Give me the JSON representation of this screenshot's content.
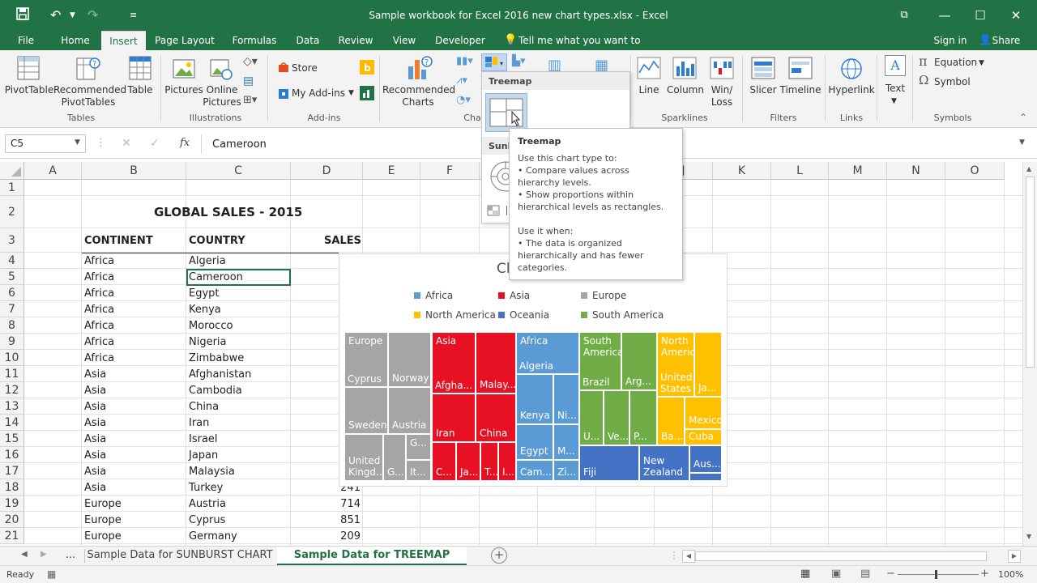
{
  "window": {
    "title": "Sample workbook for Excel 2016 new chart types.xlsx - Excel",
    "controls": [
      "⧉",
      "—",
      "☐",
      "✕"
    ]
  },
  "tabs": {
    "items": [
      "File",
      "Home",
      "Insert",
      "Page Layout",
      "Formulas",
      "Data",
      "Review",
      "View",
      "Developer"
    ],
    "active": "Insert",
    "tell_me": "Tell me what you want to do",
    "sign_in": "Sign in",
    "share": "Share"
  },
  "ribbon": {
    "pivottable": "PivotTable",
    "recommended_pivot_1": "Recommended",
    "recommended_pivot_2": "PivotTables",
    "table": "Table",
    "pictures": "Pictures",
    "online_1": "Online",
    "online_2": "Pictures",
    "store": "Store",
    "my_addins": "My Add-ins",
    "recommended_charts_1": "Recommended",
    "recommended_charts_2": "Charts",
    "line": "Line",
    "column": "Column",
    "winloss_1": "Win/",
    "winloss_2": "Loss",
    "slicer": "Slicer",
    "timeline": "Timeline",
    "hyperlink": "Hyperlink",
    "text": "Text",
    "equation": "Equation",
    "symbol": "Symbol",
    "groups": {
      "tables": "Tables",
      "illustrations": "Illustrations",
      "addins": "Add-ins",
      "charts": "Cha",
      "sparklines": "Sparklines",
      "filters": "Filters",
      "links": "Links",
      "symbols": "Symbols"
    }
  },
  "formula_bar": {
    "name_box": "C5",
    "fx": "fx",
    "value": "Cameroon"
  },
  "columns": [
    "A",
    "B",
    "C",
    "D",
    "E",
    "F",
    "G",
    "H",
    "I",
    "J",
    "K",
    "L",
    "M",
    "N",
    "O"
  ],
  "rows": [
    "1",
    "2",
    "3",
    "4",
    "5",
    "6",
    "7",
    "8",
    "9",
    "10",
    "11",
    "12",
    "13",
    "14",
    "15",
    "16",
    "17",
    "18",
    "19",
    "20",
    "21"
  ],
  "sheet": {
    "title": "GLOBAL SALES - 2015",
    "headers": {
      "continent": "CONTINENT",
      "country": "COUNTRY",
      "sales": "SALES"
    },
    "data": [
      {
        "continent": "Africa",
        "country": "Algeria",
        "sales": ""
      },
      {
        "continent": "Africa",
        "country": "Cameroon",
        "sales": ""
      },
      {
        "continent": "Africa",
        "country": "Egypt",
        "sales": ""
      },
      {
        "continent": "Africa",
        "country": "Kenya",
        "sales": ""
      },
      {
        "continent": "Africa",
        "country": "Morocco",
        "sales": ""
      },
      {
        "continent": "Africa",
        "country": "Nigeria",
        "sales": ""
      },
      {
        "continent": "Africa",
        "country": "Zimbabwe",
        "sales": ""
      },
      {
        "continent": "Asia",
        "country": "Afghanistan",
        "sales": ""
      },
      {
        "continent": "Asia",
        "country": "Cambodia",
        "sales": ""
      },
      {
        "continent": "Asia",
        "country": "China",
        "sales": ""
      },
      {
        "continent": "Asia",
        "country": "Iran",
        "sales": ""
      },
      {
        "continent": "Asia",
        "country": "Israel",
        "sales": ""
      },
      {
        "continent": "Asia",
        "country": "Japan",
        "sales": ""
      },
      {
        "continent": "Asia",
        "country": "Malaysia",
        "sales": ""
      },
      {
        "continent": "Asia",
        "country": "Turkey",
        "sales": "241"
      },
      {
        "continent": "Europe",
        "country": "Austria",
        "sales": "714"
      },
      {
        "continent": "Europe",
        "country": "Cyprus",
        "sales": "851"
      },
      {
        "continent": "Europe",
        "country": "Germany",
        "sales": "209"
      }
    ]
  },
  "chart": {
    "title_partial": "Ch",
    "legend": [
      {
        "name": "Africa",
        "color": "#5b9bd5"
      },
      {
        "name": "Asia",
        "color": "#e81123"
      },
      {
        "name": "Europe",
        "color": "#a5a5a5"
      },
      {
        "name": "North America",
        "color": "#ffc000"
      },
      {
        "name": "Oceania",
        "color": "#4472c4"
      },
      {
        "name": "South America",
        "color": "#70ad47"
      }
    ],
    "tiles": {
      "europe": "Europe",
      "cyprus": "Cyprus",
      "norway": "Norway",
      "sweden": "Sweden",
      "austria": "Austria",
      "united_kingdom": "United Kingd...",
      "g1": "G...",
      "g2": "G...",
      "it": "It...",
      "asia": "Asia",
      "afghanistan": "Afgha...",
      "malaysia": "Malay...",
      "iran": "Iran",
      "china": "China",
      "c": "C...",
      "ja": "Ja...",
      "t": "T...",
      "i": "I...",
      "africa": "Africa",
      "algeria": "Algeria",
      "kenya": "Kenya",
      "ni": "Ni...",
      "egypt": "Egypt",
      "m": "M...",
      "cam": "Cam...",
      "zi": "Zi...",
      "south_america": "South America",
      "brazil": "Brazil",
      "arg": "Arg...",
      "u": "U...",
      "ve": "Ve...",
      "p": "P...",
      "north_america": "North America",
      "united_states": "United States",
      "ja2": "Ja...",
      "mexico": "Mexico",
      "ba": "Ba...",
      "cuba": "Cuba",
      "fiji": "Fiji",
      "new_zealand": "New Zealand",
      "aus": "Aus..."
    }
  },
  "dropdown": {
    "treemap_header": "Treemap",
    "sunburst_header": "Sunb"
  },
  "tooltip": {
    "title": "Treemap",
    "intro": "Use this chart type to:",
    "bullet1": "• Compare values across hierarchy levels.",
    "bullet2": "• Show proportions within hierarchical levels as rectangles.",
    "use_when": "Use it when:",
    "bullet3": "• The data is organized hierarchically and has fewer categories."
  },
  "sheet_tabs": {
    "more": "...",
    "tab1": "Sample Data for SUNBURST CHART",
    "tab2": "Sample Data for TREEMAP CHART",
    "active": "Sample Data for TREEMAP CHART"
  },
  "status": {
    "ready": "Ready",
    "zoom": "100%"
  }
}
